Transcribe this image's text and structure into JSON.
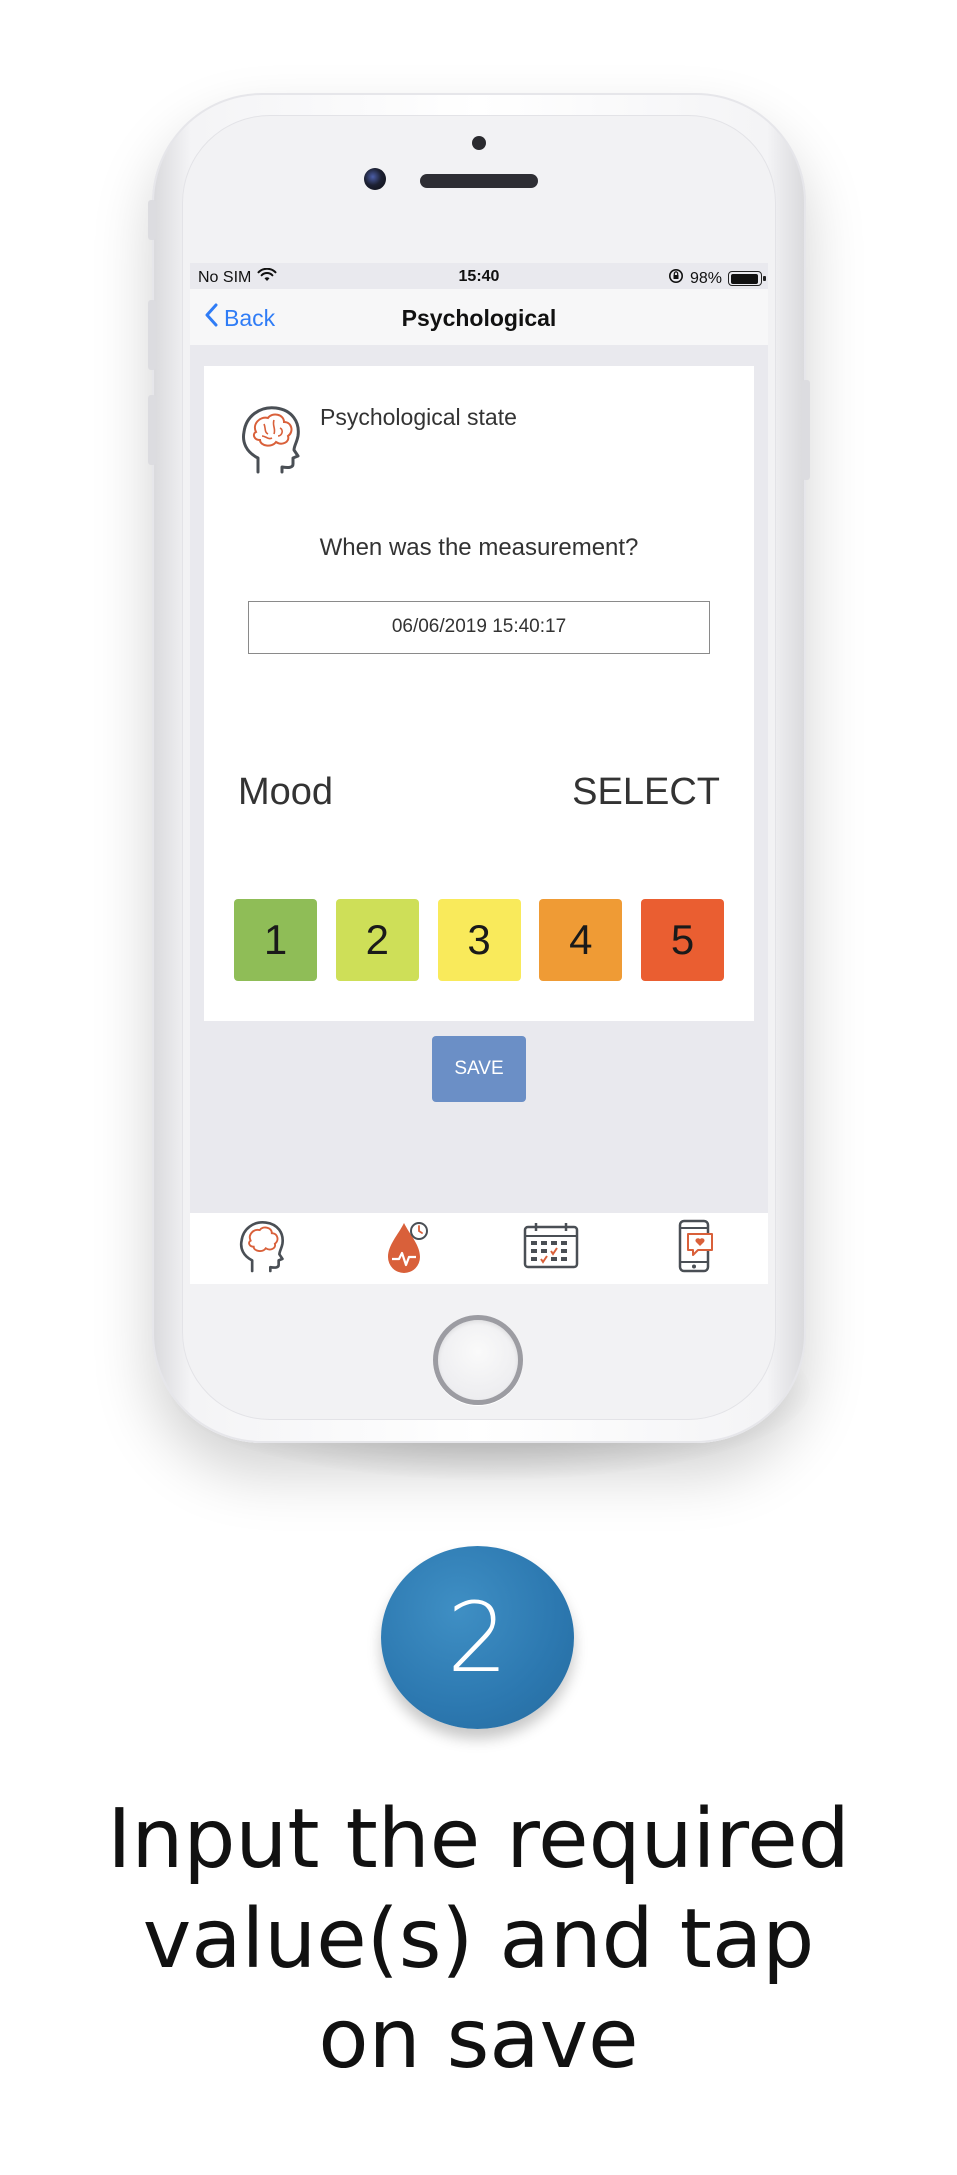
{
  "status_bar": {
    "carrier": "No SIM",
    "time": "15:40",
    "battery": "98%",
    "icons": [
      "wifi-icon",
      "rotation-lock-icon",
      "battery-icon"
    ]
  },
  "nav": {
    "back_label": "Back",
    "title": "Psychological"
  },
  "card": {
    "title": "Psychological state",
    "question": "When was the measurement?",
    "date_value": "06/06/2019 15:40:17",
    "mood_label": "Mood",
    "select_label": "SELECT",
    "scale": [
      {
        "label": "1",
        "color": "#8fbd57"
      },
      {
        "label": "2",
        "color": "#cedf58"
      },
      {
        "label": "3",
        "color": "#f9ea5b"
      },
      {
        "label": "4",
        "color": "#ef9b35"
      },
      {
        "label": "5",
        "color": "#ea5e31"
      }
    ]
  },
  "save_label": "SAVE",
  "tabs": [
    {
      "icon": "brain-head-icon",
      "active": true
    },
    {
      "icon": "blood-drop-icon",
      "active": false
    },
    {
      "icon": "calendar-icon",
      "active": false
    },
    {
      "icon": "phone-message-icon",
      "active": false
    }
  ],
  "step": {
    "number": "2",
    "caption_lines": [
      "Input the required",
      "value(s) and tap",
      "on save"
    ]
  },
  "colors": {
    "accent_blue": "#2f7cf6",
    "save_button": "#6b8fc6",
    "badge": "#2c78b0",
    "icon_orange": "#d9603a",
    "icon_gray": "#4a4f55"
  }
}
